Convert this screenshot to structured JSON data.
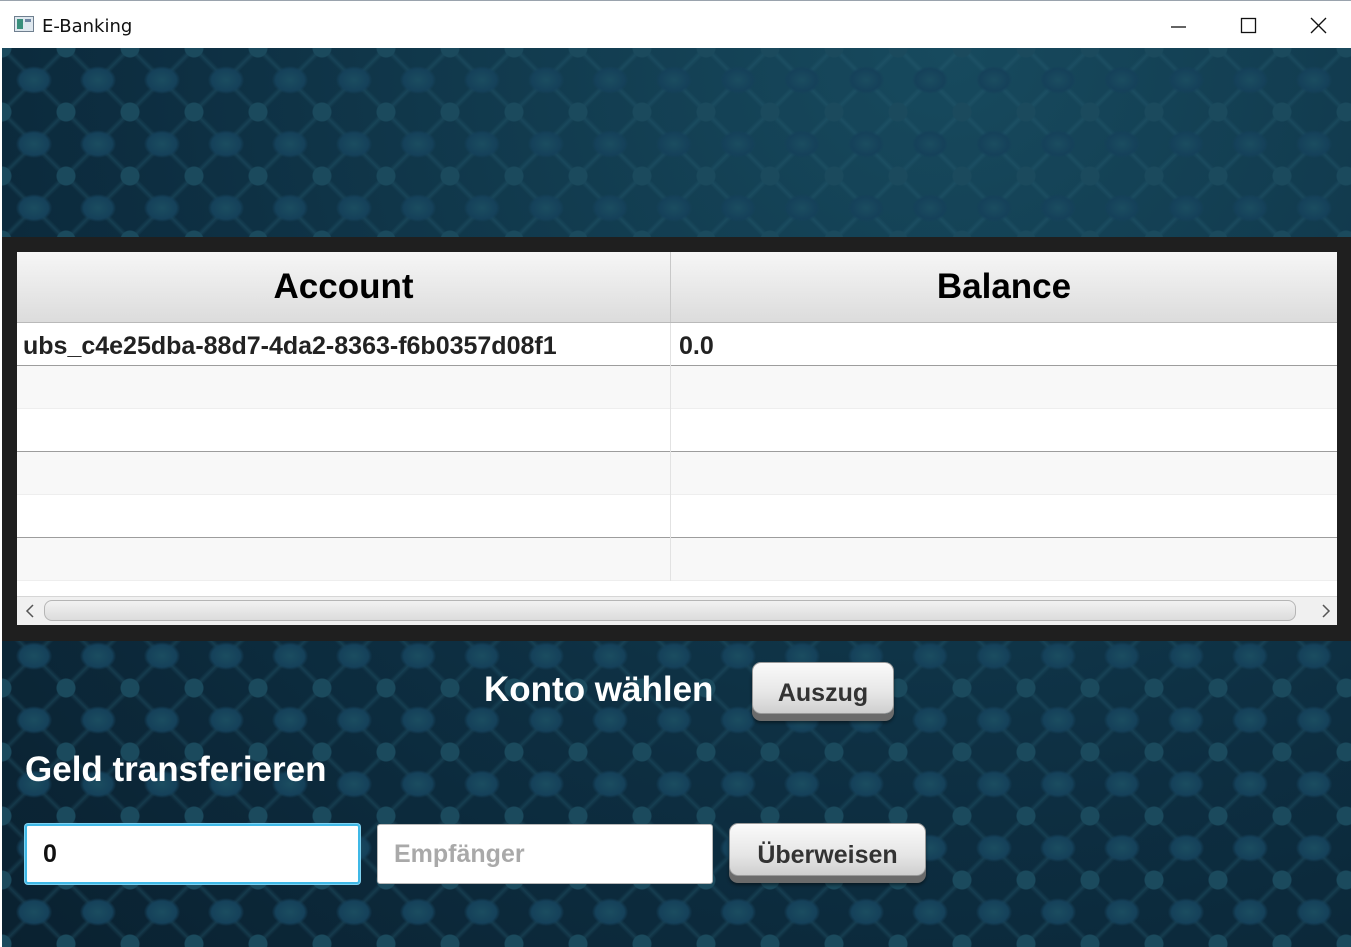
{
  "window": {
    "title": "E-Banking",
    "controls": [
      "minimize-icon",
      "maximize-icon",
      "close-icon"
    ]
  },
  "table": {
    "columns": [
      "Account",
      "Balance"
    ],
    "rows": [
      {
        "account": "ubs_c4e25dba-88d7-4da2-8363-f6b0357d08f1",
        "balance": "0.0"
      }
    ]
  },
  "controls": {
    "konto_label": "Konto wählen",
    "auszug_button": "Auszug",
    "geld_label": "Geld transferieren",
    "amount_value": "0",
    "recipient_placeholder": "Empfänger",
    "recipient_value": "",
    "transfer_button": "Überweisen"
  },
  "colors": {
    "background": "#0c2838",
    "focus_ring": "#3fb8e6"
  }
}
